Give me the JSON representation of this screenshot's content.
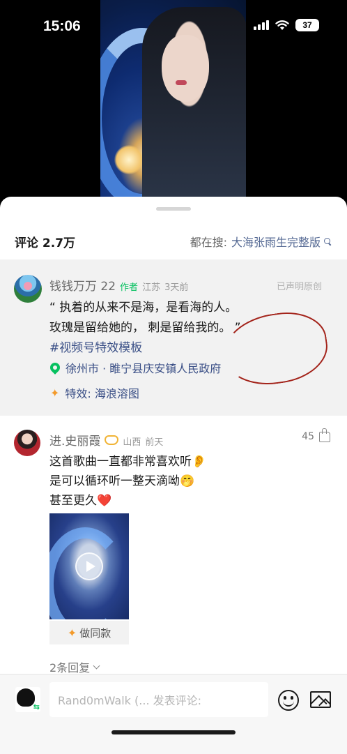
{
  "status_bar": {
    "time": "15:06",
    "battery": "37",
    "icons": [
      "signal-icon",
      "wifi-icon",
      "battery-icon"
    ]
  },
  "video": {
    "description_icon": "video-thumbnail"
  },
  "comments": {
    "count_label": "评论 2.7万",
    "search_prefix": "都在搜:",
    "search_term": "大海张雨生完整版",
    "search_icon": "search-icon"
  },
  "author_comment": {
    "name": "钱钱万万 22",
    "tag": "作者",
    "region": "江苏",
    "time": "3天前",
    "declared": "已声明原创",
    "text_line1": "“ 执着的从来不是海，是看海的人。",
    "text_line2": "玫瑰是留给她的，  刺是留给我的。 ”",
    "hashtag": "#视频号特效模板",
    "location": "徐州市 · 睢宁县庆安镇人民政府",
    "effect": "特效: 海浪溶图"
  },
  "comment2": {
    "name": "进.史丽霞",
    "region": "山西",
    "time": "前天",
    "likes": "45",
    "line1": "这首歌曲一直都非常喜欢听",
    "line1_emoji": "👂",
    "line2": "是可以循环听一整天滴呦",
    "line2_emoji": "🤭",
    "line3": "甚至更久",
    "line3_emoji": "❤️",
    "make_same": "做同款",
    "replies": "2条回复"
  },
  "input_bar": {
    "placeholder": "Rand0mWalk (... 发表评论:",
    "emoji_icon": "smile-icon",
    "image_icon": "image-icon"
  },
  "colors": {
    "link": "#576b95",
    "green": "#07c160",
    "annotation_red": "#a3231a"
  }
}
